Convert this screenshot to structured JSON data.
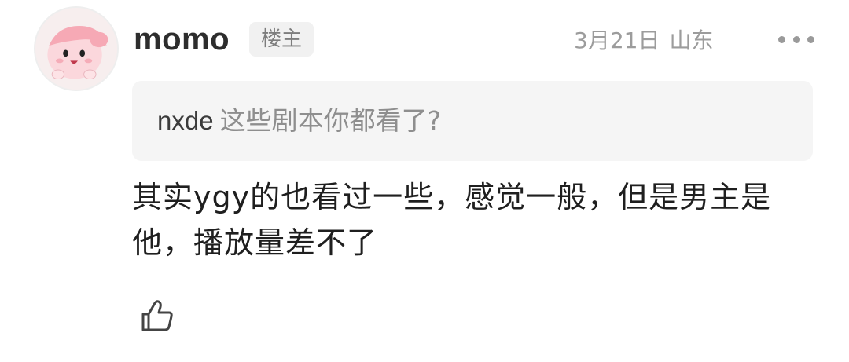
{
  "post": {
    "username": "momo",
    "op_badge": "楼主",
    "date": "3月21日",
    "location": "山东",
    "quote": {
      "user": "nxde",
      "text": "这些剧本你都看了?"
    },
    "comment": "其实ygy的也看过一些，感觉一般，但是男主是他，播放量差不了"
  },
  "icons": {
    "more": "more-dots-icon",
    "like": "thumbs-up-icon",
    "avatar": "pink-cartoon-avatar"
  },
  "colors": {
    "badge_bg": "#f1f1f1",
    "quote_bg": "#f5f5f5",
    "meta_text": "#9c9c9c"
  }
}
